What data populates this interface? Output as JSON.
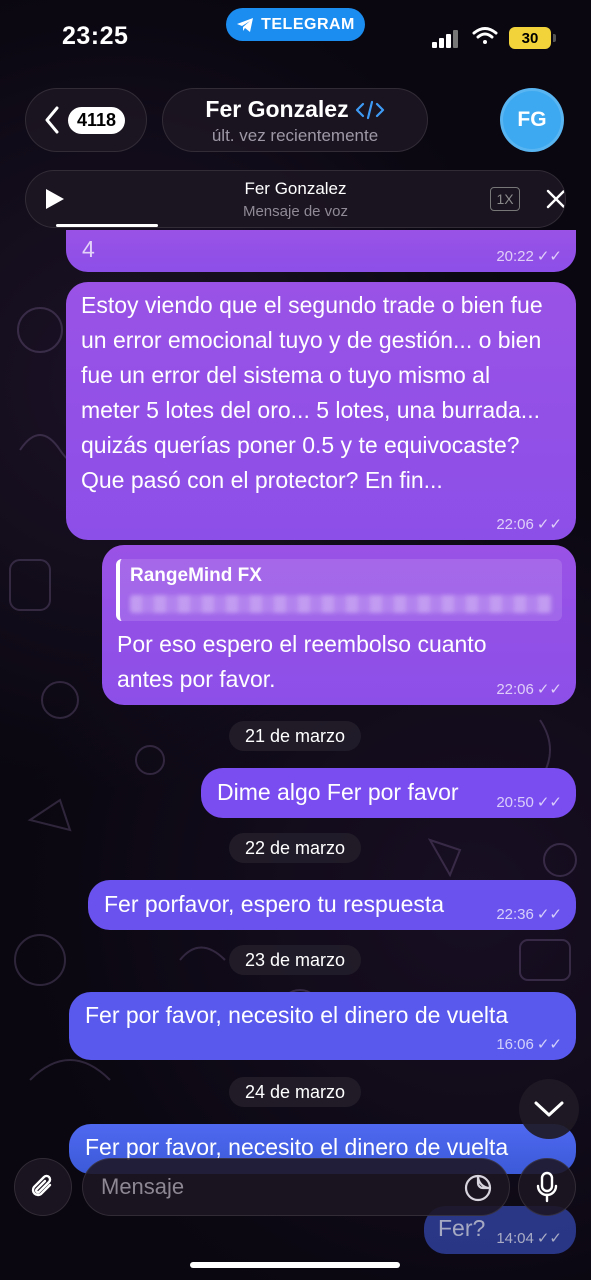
{
  "status_bar": {
    "time": "23:25",
    "app_pill": "TELEGRAM",
    "battery": "30"
  },
  "header": {
    "back_count": "4118",
    "contact_name": "Fer Gonzalez",
    "contact_status": "últ. vez recientemente",
    "avatar_initials": "FG"
  },
  "voice_player": {
    "name": "Fer Gonzalez",
    "subtitle": "Mensaje de voz",
    "speed": "1X",
    "progress": 0.19
  },
  "messages": {
    "m1": {
      "text": "4",
      "time": "20:22"
    },
    "m2": {
      "text": "Estoy viendo que el segundo trade o bien fue un error emocional tuyo y de gestión... o bien fue un error del sistema o tuyo mismo al meter 5 lotes del oro... 5 lotes, una burrada... quizás querías poner 0.5 y te equivocaste? Que pasó con el protector? En fin...",
      "time": "22:06"
    },
    "m3": {
      "quote_name": "RangeMind FX",
      "text": "Por eso espero el reembolso cuanto antes por favor.",
      "time": "22:06"
    },
    "m4": {
      "text": "Dime algo Fer por favor",
      "time": "20:50"
    },
    "m5": {
      "text": "Fer porfavor, espero tu respuesta",
      "time": "22:36"
    },
    "m6": {
      "text": "Fer por favor, necesito el dinero de vuelta",
      "time": "16:06"
    },
    "m7": {
      "text": "Fer por favor, necesito el dinero de vuelta"
    },
    "m8": {
      "text": "Fer?",
      "time": "14:04"
    }
  },
  "dates": {
    "d1": "21 de marzo",
    "d2": "22 de marzo",
    "d3": "23 de marzo",
    "d4": "24 de marzo"
  },
  "composer": {
    "placeholder": "Mensaje"
  },
  "colors": {
    "bubble_purple": "#9a52e6",
    "bubble_violet": "#7a4df0",
    "bubble_blue": "#5a59ee",
    "telegram_blue": "#1c8df0",
    "avatar": "#3da9f0"
  }
}
